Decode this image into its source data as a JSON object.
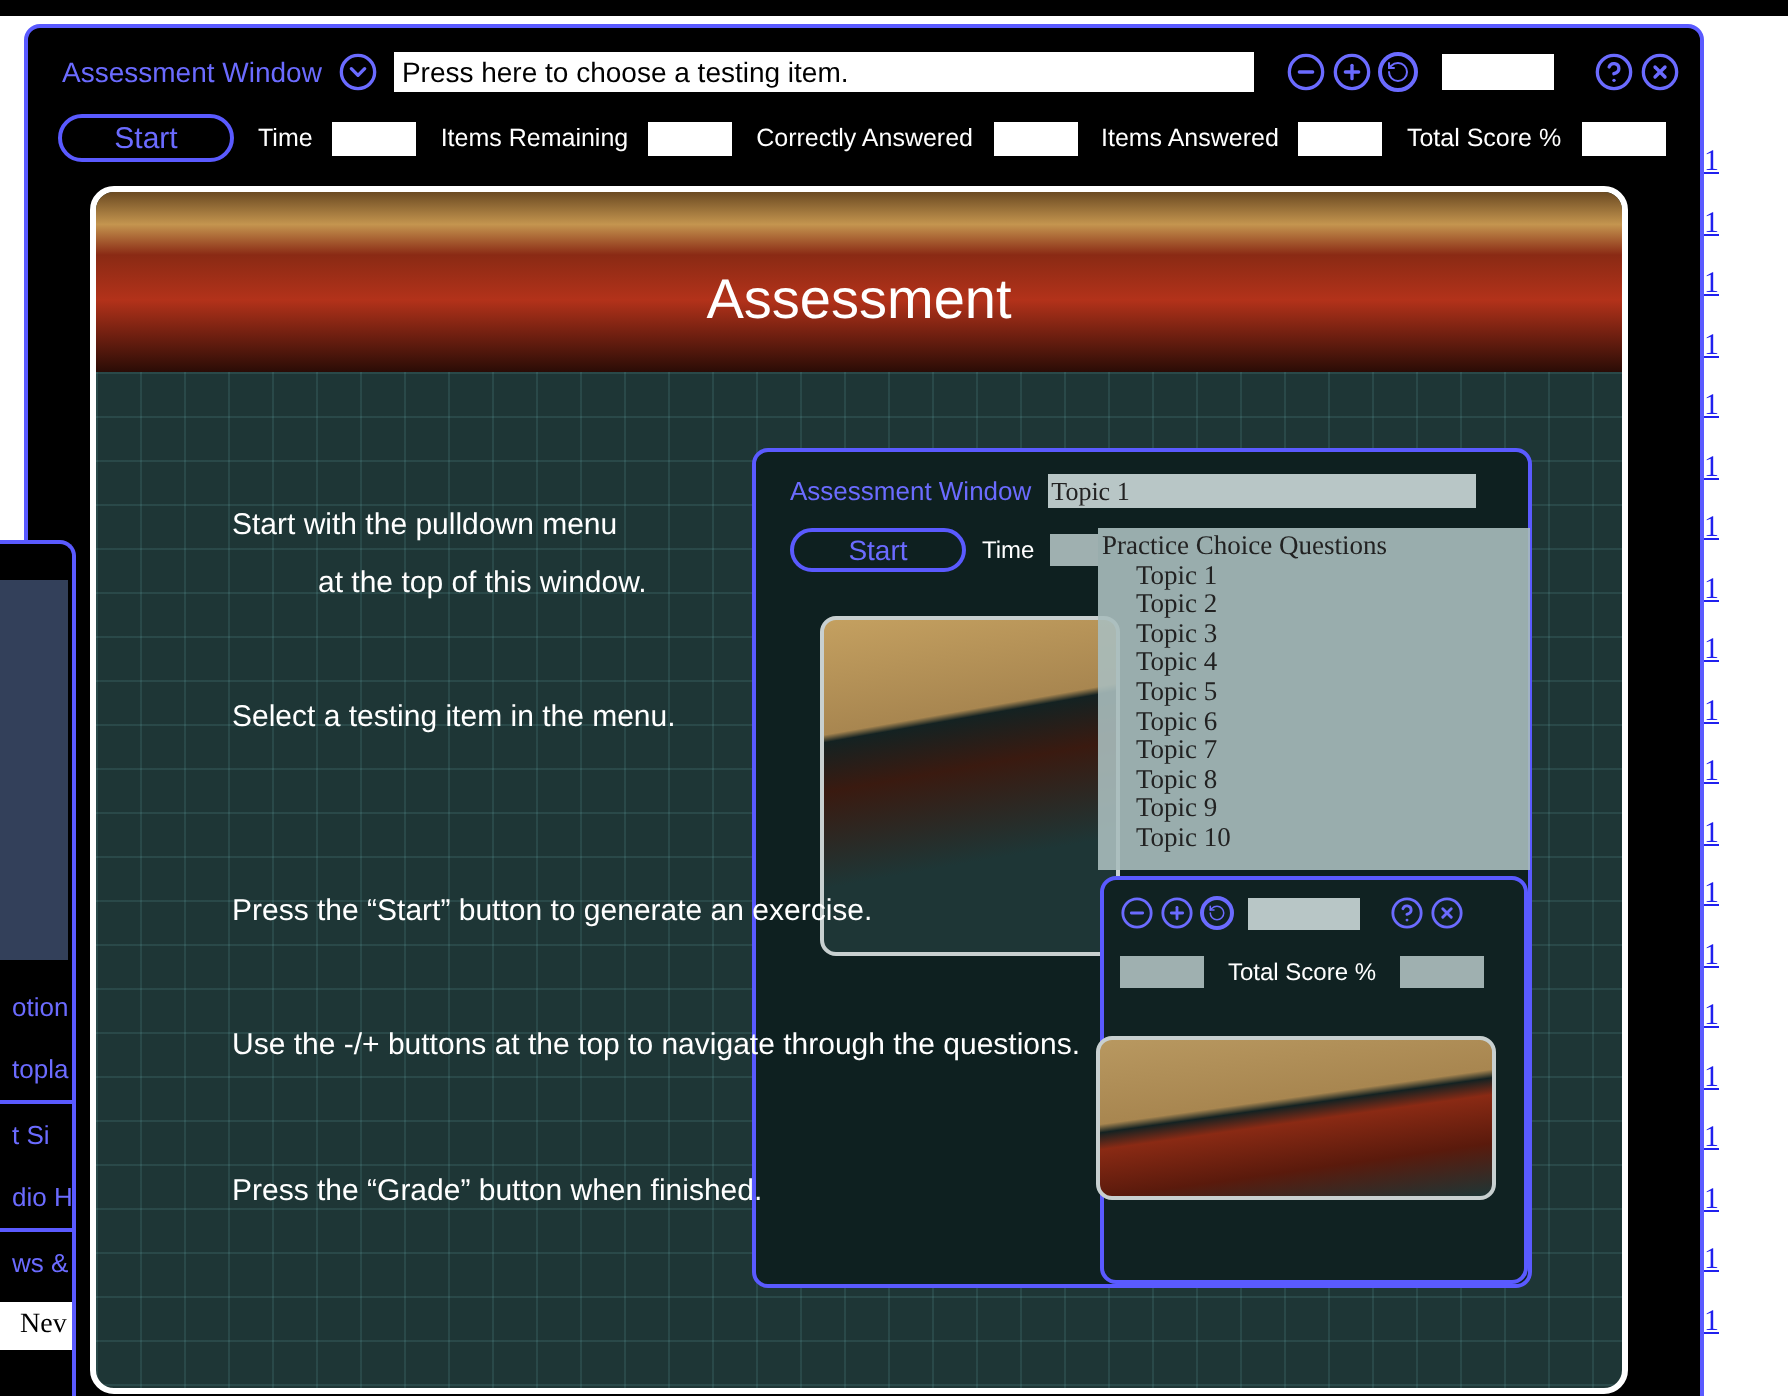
{
  "page_right_links": [
    "1",
    "1",
    "1",
    "1",
    "1",
    "1",
    "1",
    "1",
    "1",
    "1",
    "1",
    "1",
    "1",
    "1",
    "1",
    "1",
    "1",
    "1",
    "1",
    "1"
  ],
  "page_left_links": [
    {
      "text": "otion",
      "kind": "link"
    },
    {
      "text": "topla",
      "kind": "link"
    },
    {
      "text": "t Si",
      "kind": "link"
    },
    {
      "text": "dio H",
      "kind": "link"
    },
    {
      "text": "ws &",
      "kind": "link"
    },
    {
      "text": "Nev",
      "kind": "plain"
    }
  ],
  "window": {
    "title": "Assessment Window",
    "item_field": {
      "value": "Press here to choose a testing item."
    }
  },
  "start_button": "Start",
  "stats": [
    "Time",
    "Items Remaining",
    "Correctly Answered",
    "Items Answered",
    "Total Score %"
  ],
  "banner": "Assessment",
  "instructions": [
    {
      "lines": [
        "Start with the pulldown menu",
        "at the top of this window."
      ]
    },
    {
      "lines": [
        "Select a testing item in the menu."
      ]
    },
    {
      "lines": [
        "Press the “Start” button to generate an exercise."
      ]
    },
    {
      "lines": [
        "Use the -/+ buttons at the top to navigate through the questions."
      ]
    },
    {
      "lines": [
        "Press the “Grade” button when finished."
      ]
    }
  ],
  "inset": {
    "title": "Assessment Window",
    "topic_field": {
      "value": "Topic 1"
    },
    "start_button": "Start",
    "time_label": "Time",
    "dropdown": {
      "group": "Practice Choice Questions",
      "items": [
        "Topic 1",
        "Topic 2",
        "Topic 3",
        "Topic 4",
        "Topic 5",
        "Topic 6",
        "Topic 7",
        "Topic 8",
        "Topic 9",
        "Topic 10"
      ]
    },
    "score_label": "Total Score %"
  }
}
